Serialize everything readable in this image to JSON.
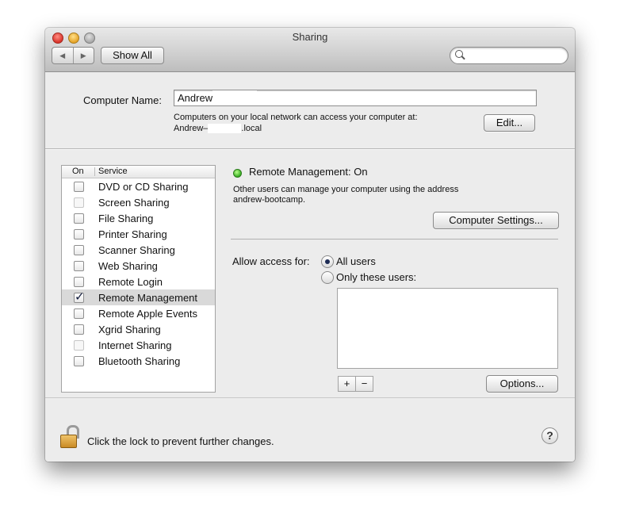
{
  "window": {
    "title": "Sharing"
  },
  "toolbar": {
    "back_glyph": "◀",
    "forward_glyph": "▶",
    "show_all_label": "Show All",
    "search_placeholder": ""
  },
  "computer_name": {
    "label": "Computer Name:",
    "value": "Andrew",
    "address_line1": "Computers on your local network can access your computer at:",
    "address_prefix": "Andrew–",
    "address_suffix": ".local",
    "edit_button": "Edit..."
  },
  "services": {
    "header_on": "On",
    "header_service": "Service",
    "items": [
      {
        "label": "DVD or CD Sharing",
        "checked": false,
        "enabled": true
      },
      {
        "label": "Screen Sharing",
        "checked": false,
        "enabled": false
      },
      {
        "label": "File Sharing",
        "checked": false,
        "enabled": true
      },
      {
        "label": "Printer Sharing",
        "checked": false,
        "enabled": true
      },
      {
        "label": "Scanner Sharing",
        "checked": false,
        "enabled": true
      },
      {
        "label": "Web Sharing",
        "checked": false,
        "enabled": true
      },
      {
        "label": "Remote Login",
        "checked": false,
        "enabled": true
      },
      {
        "label": "Remote Management",
        "checked": true,
        "enabled": true,
        "selected": true
      },
      {
        "label": "Remote Apple Events",
        "checked": false,
        "enabled": true
      },
      {
        "label": "Xgrid Sharing",
        "checked": false,
        "enabled": true
      },
      {
        "label": "Internet Sharing",
        "checked": false,
        "enabled": false
      },
      {
        "label": "Bluetooth Sharing",
        "checked": false,
        "enabled": true
      }
    ]
  },
  "detail": {
    "status": "Remote Management: On",
    "status_color": "#2ea81a",
    "description_line1": "Other users can manage your computer using the address",
    "description_line2": "andrew-bootcamp.",
    "computer_settings_button": "Computer Settings...",
    "allow_access_label": "Allow access for:",
    "radio_all_users": "All users",
    "radio_only_these": "Only these users:",
    "selected_access": "All users",
    "add_button": "+",
    "remove_button": "−",
    "options_button": "Options..."
  },
  "footer": {
    "lock_text": "Click the lock to prevent further changes.",
    "help_glyph": "?"
  }
}
